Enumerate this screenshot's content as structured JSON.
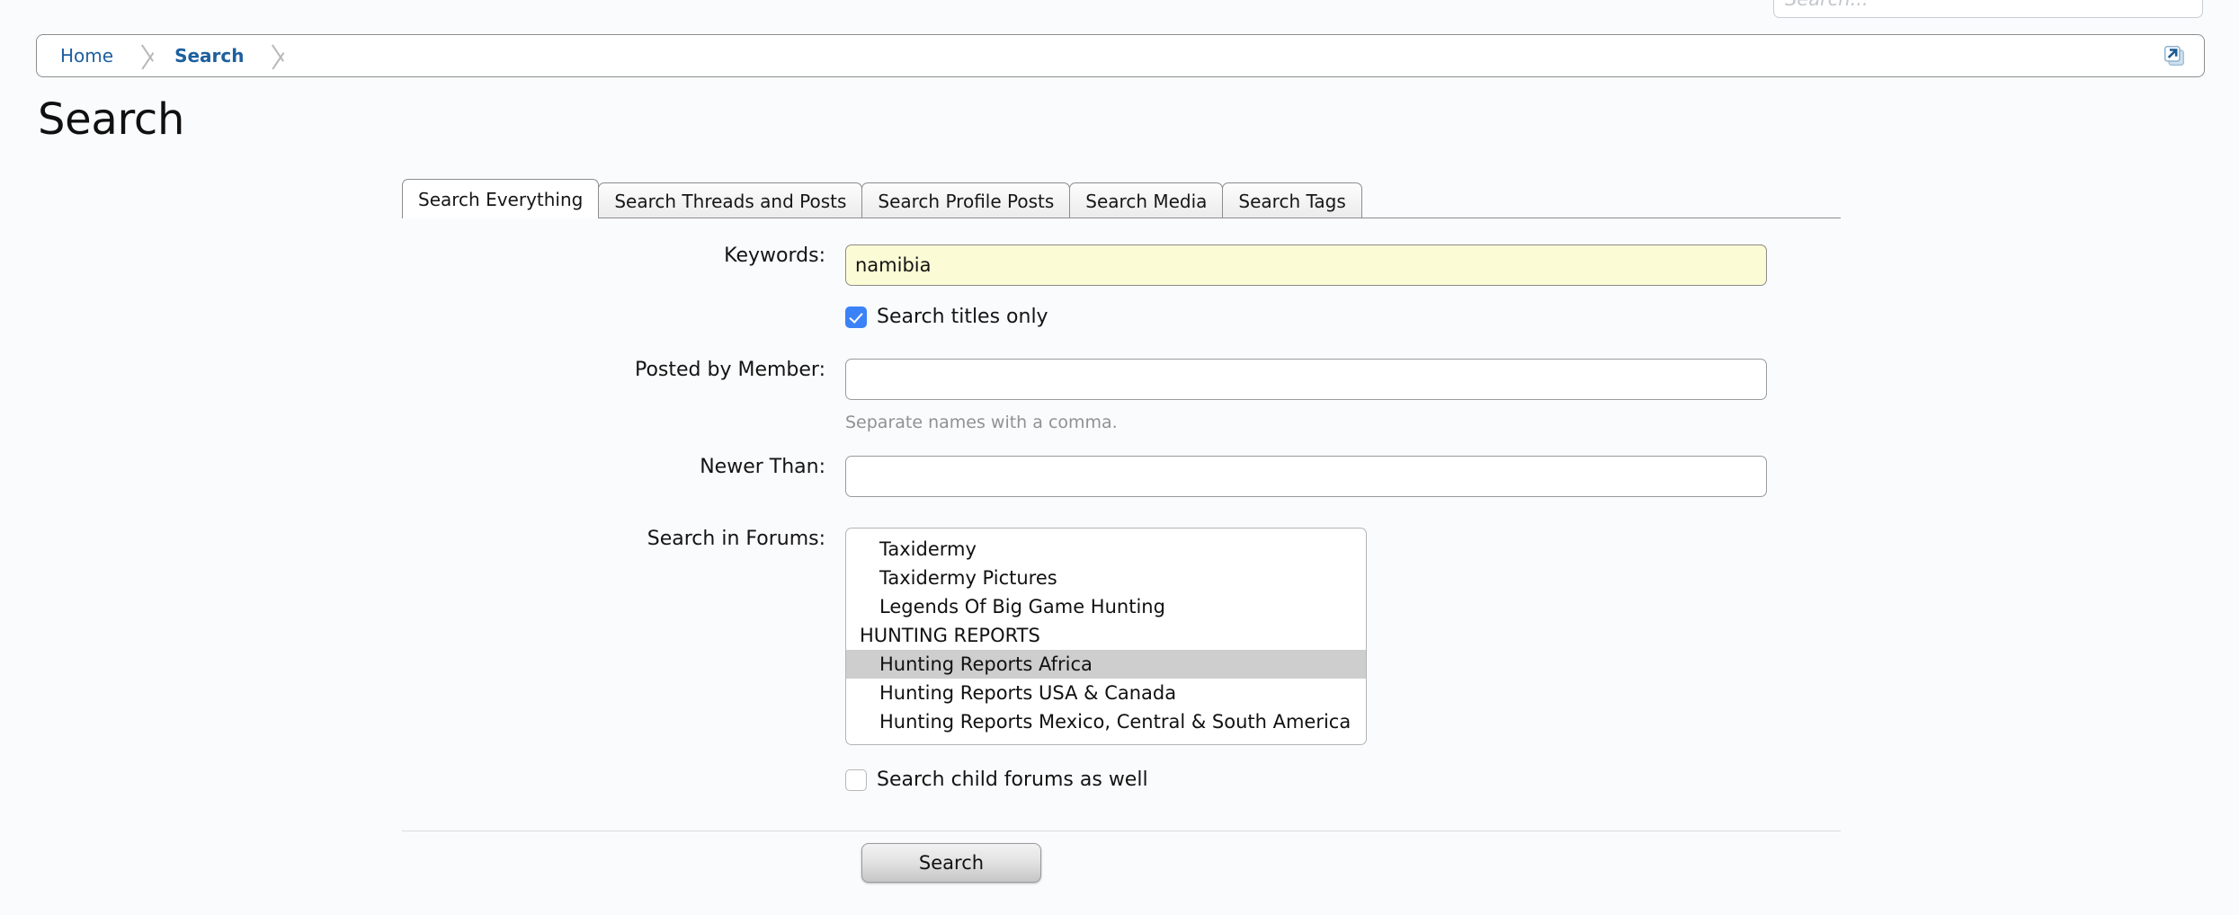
{
  "top_search": {
    "placeholder": "Search...",
    "value": ""
  },
  "breadcrumb": {
    "items": [
      {
        "label": "Home",
        "bold": false
      },
      {
        "label": "Search",
        "bold": true
      }
    ],
    "external_link_icon": "external-link-icon"
  },
  "page": {
    "title": "Search"
  },
  "tabs": [
    {
      "label": "Search Everything",
      "active": true
    },
    {
      "label": "Search Threads and Posts",
      "active": false
    },
    {
      "label": "Search Profile Posts",
      "active": false
    },
    {
      "label": "Search Media",
      "active": false
    },
    {
      "label": "Search Tags",
      "active": false
    }
  ],
  "form": {
    "keywords": {
      "label": "Keywords:",
      "value": "namibia",
      "placeholder": ""
    },
    "titles_only": {
      "label": "Search titles only",
      "checked": true
    },
    "posted_by": {
      "label": "Posted by Member:",
      "value": "",
      "placeholder": "",
      "hint": "Separate names with a comma."
    },
    "newer_than": {
      "label": "Newer Than:",
      "value": "",
      "placeholder": ""
    },
    "forums": {
      "label": "Search in Forums:",
      "options": [
        {
          "label": "Taxidermy",
          "type": "option",
          "selected": false
        },
        {
          "label": "Taxidermy Pictures",
          "type": "option",
          "selected": false
        },
        {
          "label": "Legends Of Big Game Hunting",
          "type": "option",
          "selected": false
        },
        {
          "label": "HUNTING REPORTS",
          "type": "group",
          "selected": false
        },
        {
          "label": "Hunting Reports Africa",
          "type": "option",
          "selected": true
        },
        {
          "label": "Hunting Reports USA & Canada",
          "type": "option",
          "selected": false
        },
        {
          "label": "Hunting Reports Mexico, Central & South America",
          "type": "option",
          "selected": false
        }
      ]
    },
    "child_forums": {
      "label": "Search child forums as well",
      "checked": false
    },
    "submit": {
      "label": "Search"
    }
  },
  "colors": {
    "page_background": "#fafbfd",
    "link": "#1e5f9e",
    "checkbox_checked": "#3b82f6",
    "autofill_field": "#fbfbd5",
    "selected_option": "#cecece"
  }
}
